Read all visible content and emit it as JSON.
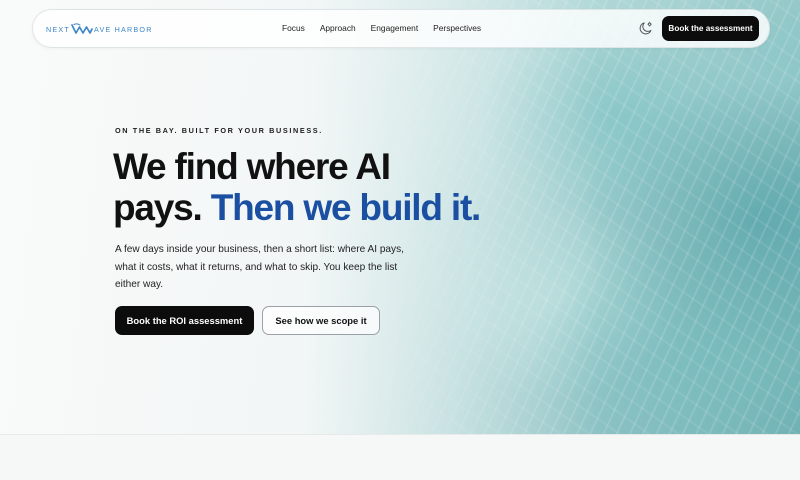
{
  "brand": {
    "name_left": "NEXT",
    "name_right": "AVE HARBOR",
    "logo_icon": "wave-w-icon",
    "color": "#3f86c6"
  },
  "nav": {
    "links": [
      "Focus",
      "Approach",
      "Engagement",
      "Perspectives"
    ],
    "theme_toggle_icon": "moon-sun-icon",
    "cta_label": "Book the assessment"
  },
  "hero": {
    "eyebrow": "ON THE BAY. BUILT FOR YOUR BUSINESS.",
    "headline_line1": "We find where AI",
    "headline_line2_plain": "pays.",
    "headline_line2_accent": "Then we build it.",
    "accent_color": "#1a4fa1",
    "lede": "A few days inside your business, then a short list: where AI pays, what it costs, what it returns, and what to skip. You keep the list either way.",
    "primary_cta": "Book the ROI assessment",
    "secondary_cta": "See how we scope it"
  }
}
